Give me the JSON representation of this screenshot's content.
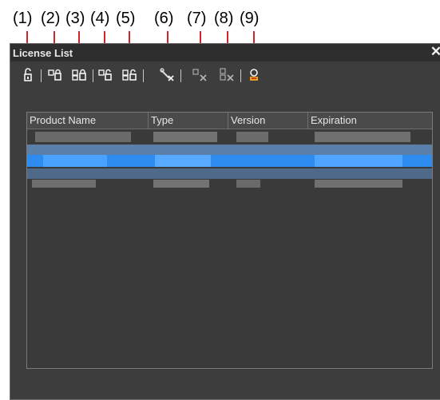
{
  "callouts": [
    "(1)",
    "(2)",
    "(3)",
    "(4)",
    "(5)",
    "(6)",
    "(7)",
    "(8)",
    "(9)"
  ],
  "window": {
    "title": "License List",
    "close": "✕"
  },
  "toolbar": {
    "tools": [
      {
        "icon": "license-install-icon"
      },
      {
        "icon": "license-import-icon"
      },
      {
        "icon": "license-import-all-icon"
      },
      {
        "icon": "license-export-icon"
      },
      {
        "icon": "license-export-all-icon"
      },
      {
        "icon": "license-remove-icon"
      },
      {
        "icon": "license-remove-disabled-icon"
      },
      {
        "icon": "license-remove-all-disabled-icon"
      },
      {
        "icon": "license-info-icon"
      }
    ]
  },
  "list": {
    "columns": [
      "Product Name",
      "Type",
      "Version",
      "Expiration"
    ],
    "rows_blurred": 4,
    "selected_row": 2,
    "colors": {
      "selected": "#2e8cf0",
      "row_blur": "#6e6e6e"
    }
  }
}
